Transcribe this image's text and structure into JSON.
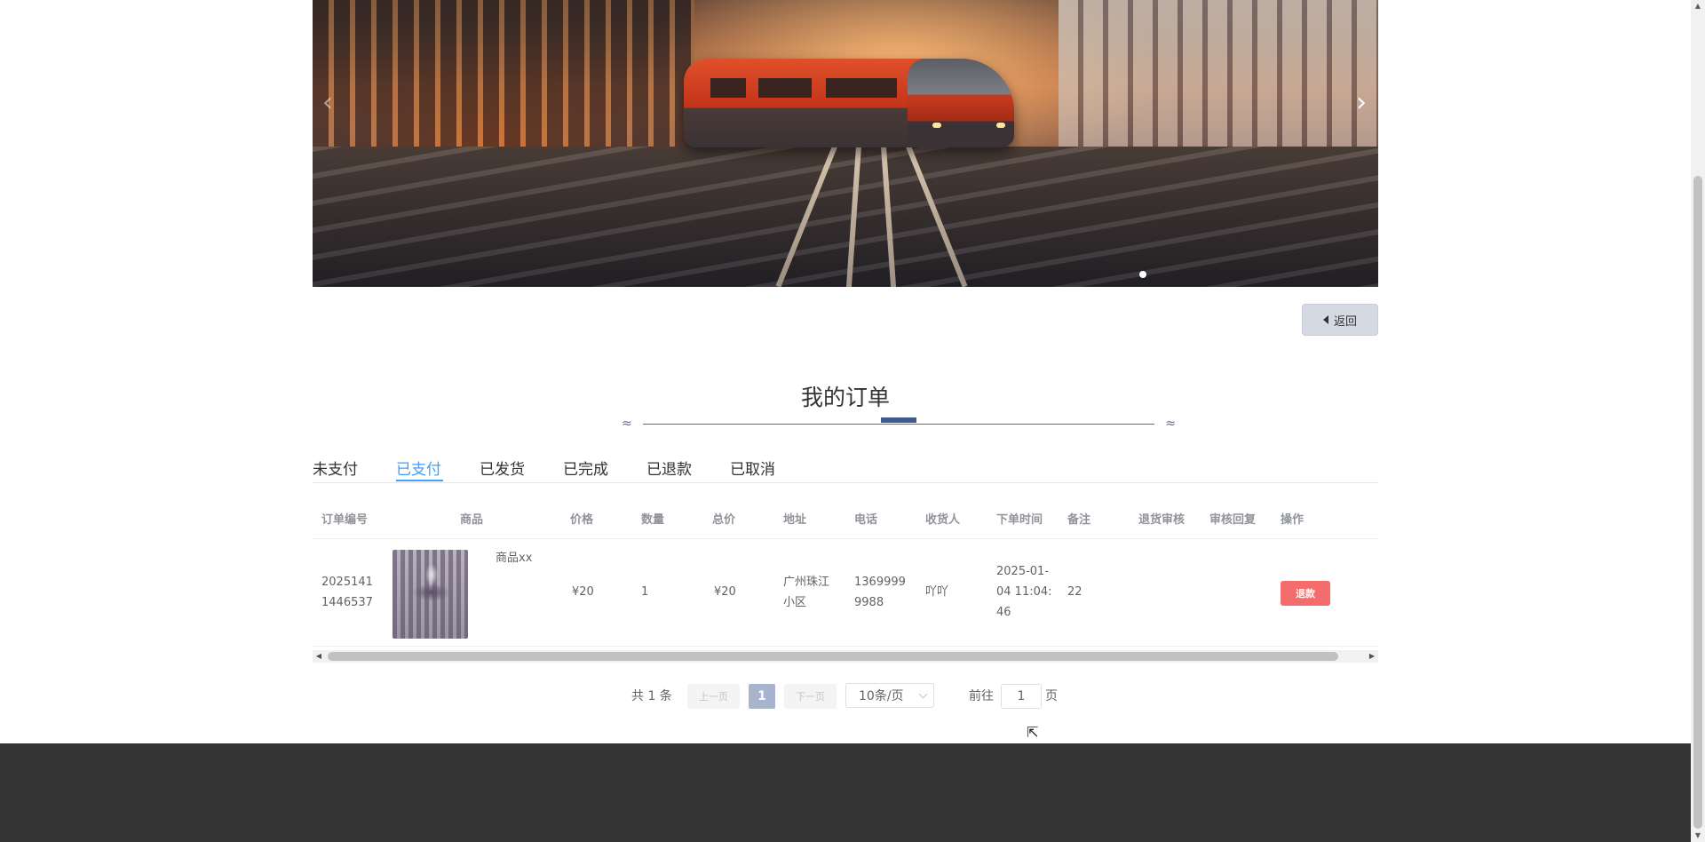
{
  "banner": {
    "prev_label": "‹",
    "next_label": "›",
    "dots": 1
  },
  "back_button": {
    "label": "返回"
  },
  "page_title": "我的订单",
  "tabs": [
    {
      "label": "未支付",
      "active": false
    },
    {
      "label": "已支付",
      "active": true
    },
    {
      "label": "已发货",
      "active": false
    },
    {
      "label": "已完成",
      "active": false
    },
    {
      "label": "已退款",
      "active": false
    },
    {
      "label": "已取消",
      "active": false
    }
  ],
  "table": {
    "headers": [
      "订单编号",
      "商品",
      "价格",
      "数量",
      "总价",
      "地址",
      "电话",
      "收货人",
      "下单时间",
      "备注",
      "退货审核",
      "审核回复",
      "操作"
    ],
    "rows": [
      {
        "order_no_1": "2025141",
        "order_no_2": "1446537",
        "product_name": "商品xx",
        "price": "¥20",
        "quantity": "1",
        "total": "¥20",
        "address_1": "广州珠江",
        "address_2": "小区",
        "phone_1": "1369999",
        "phone_2": "9988",
        "receiver": "吖吖",
        "time_1": "2025-01-",
        "time_2": "04 11:04:",
        "time_3": "46",
        "remark": "22",
        "return_review": "",
        "review_reply": "",
        "action_label": "退款"
      }
    ]
  },
  "pagination": {
    "total_text": "共 1 条",
    "prev_label": "上一页",
    "current_page": "1",
    "next_label": "下一页",
    "page_size": "10条/页",
    "goto_prefix": "前往",
    "goto_value": "1",
    "goto_suffix": "页"
  },
  "colors": {
    "accent": "#409eff",
    "danger": "#f56c6c",
    "footer": "#333333"
  }
}
